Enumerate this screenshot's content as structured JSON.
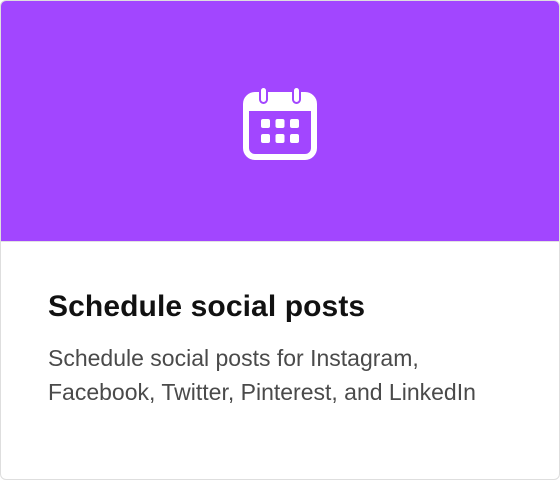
{
  "card": {
    "title": "Schedule social posts",
    "description_line1": "Schedule social posts for Instagram,",
    "description_line2": "Facebook, Twitter, Pinterest, and LinkedIn",
    "icon": "calendar-icon",
    "accent_color": "#a246ff"
  }
}
